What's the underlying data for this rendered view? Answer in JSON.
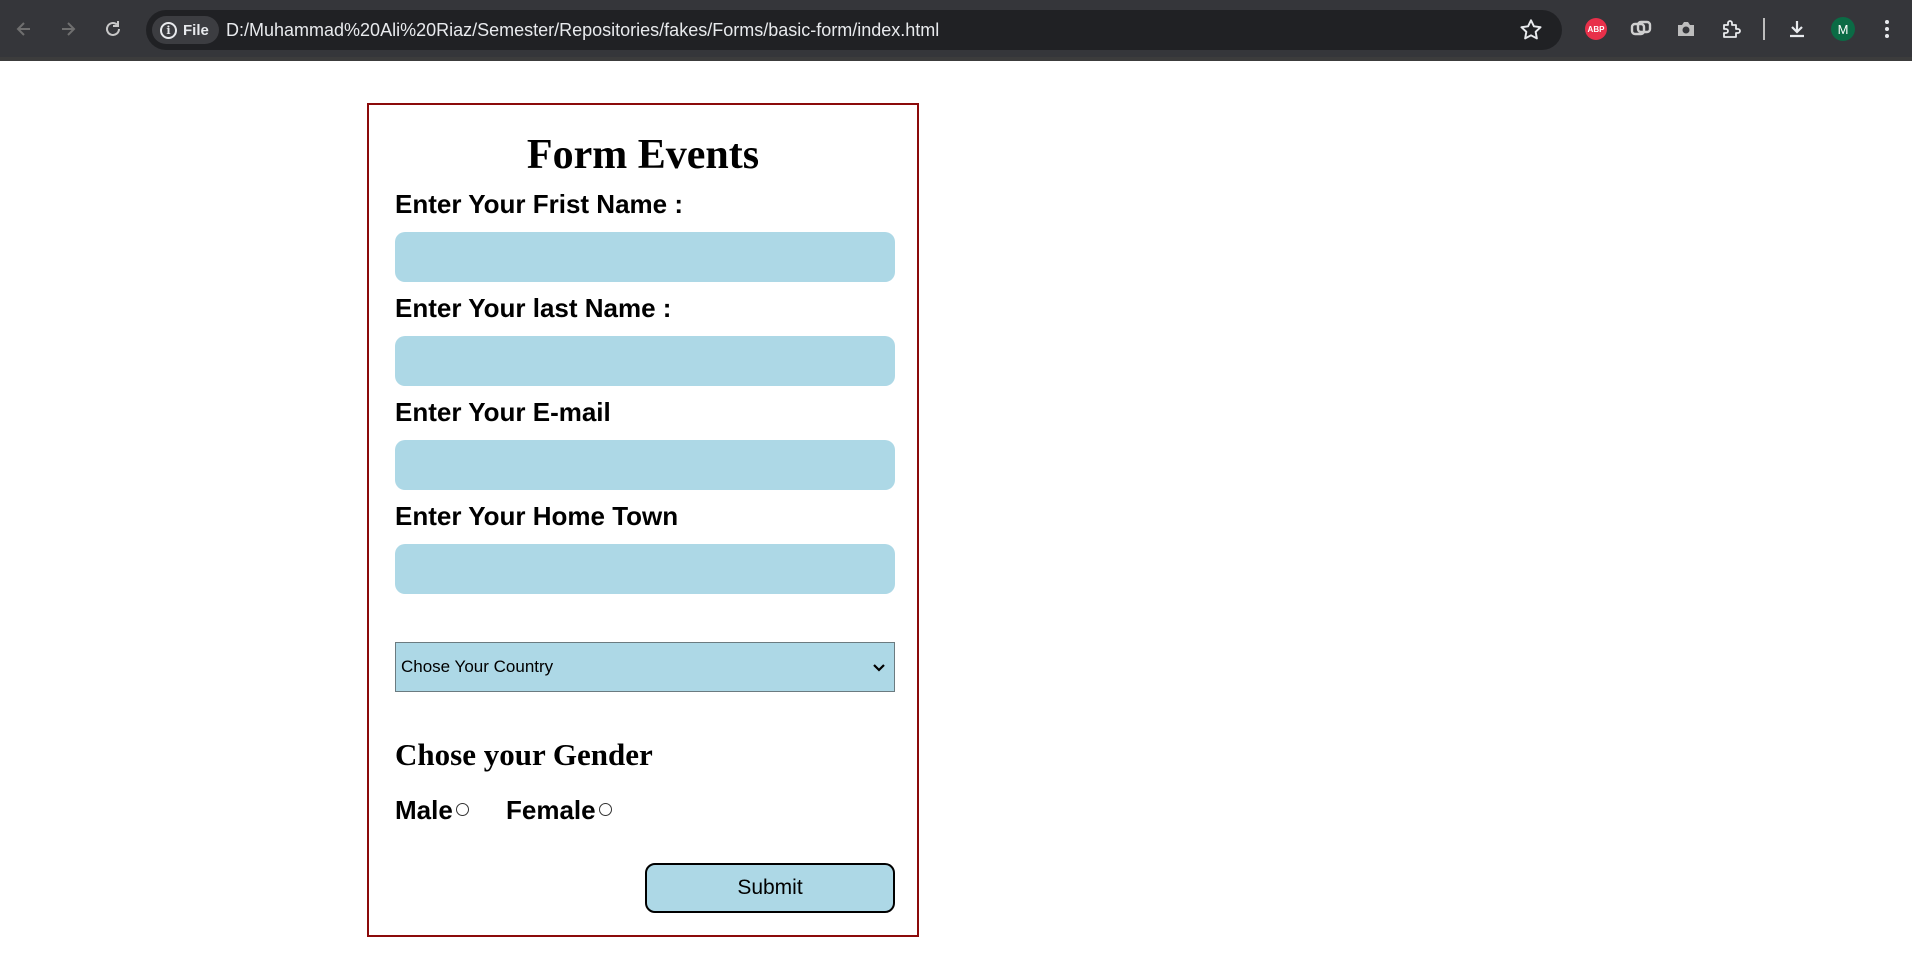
{
  "browser": {
    "site_chip_label": "File",
    "url": "D:/Muhammad%20Ali%20Riaz/Semester/Repositories/fakes/Forms/basic-form/index.html",
    "abp_label": "ABP",
    "profile_initial": "M",
    "icons": [
      "back-icon",
      "forward-icon",
      "reload-icon",
      "info-icon",
      "star-icon",
      "adblock-icon",
      "link-icon",
      "camera-icon",
      "extensions-icon",
      "download-icon",
      "menu-icon"
    ]
  },
  "form": {
    "title": "Form Events",
    "fields": [
      {
        "label": "Enter Your Frist Name :",
        "value": ""
      },
      {
        "label": "Enter Your last Name :",
        "value": ""
      },
      {
        "label": "Enter Your E-mail",
        "value": ""
      },
      {
        "label": "Enter Your Home Town",
        "value": ""
      }
    ],
    "country_select": {
      "selected": "Chose Your Country"
    },
    "gender": {
      "title": "Chose your Gender",
      "options": [
        "Male",
        "Female"
      ]
    },
    "submit_label": "Submit"
  },
  "colors": {
    "input_bg": "#add8e6",
    "form_border": "#8b0a0a",
    "chrome_bg": "#35363a"
  }
}
